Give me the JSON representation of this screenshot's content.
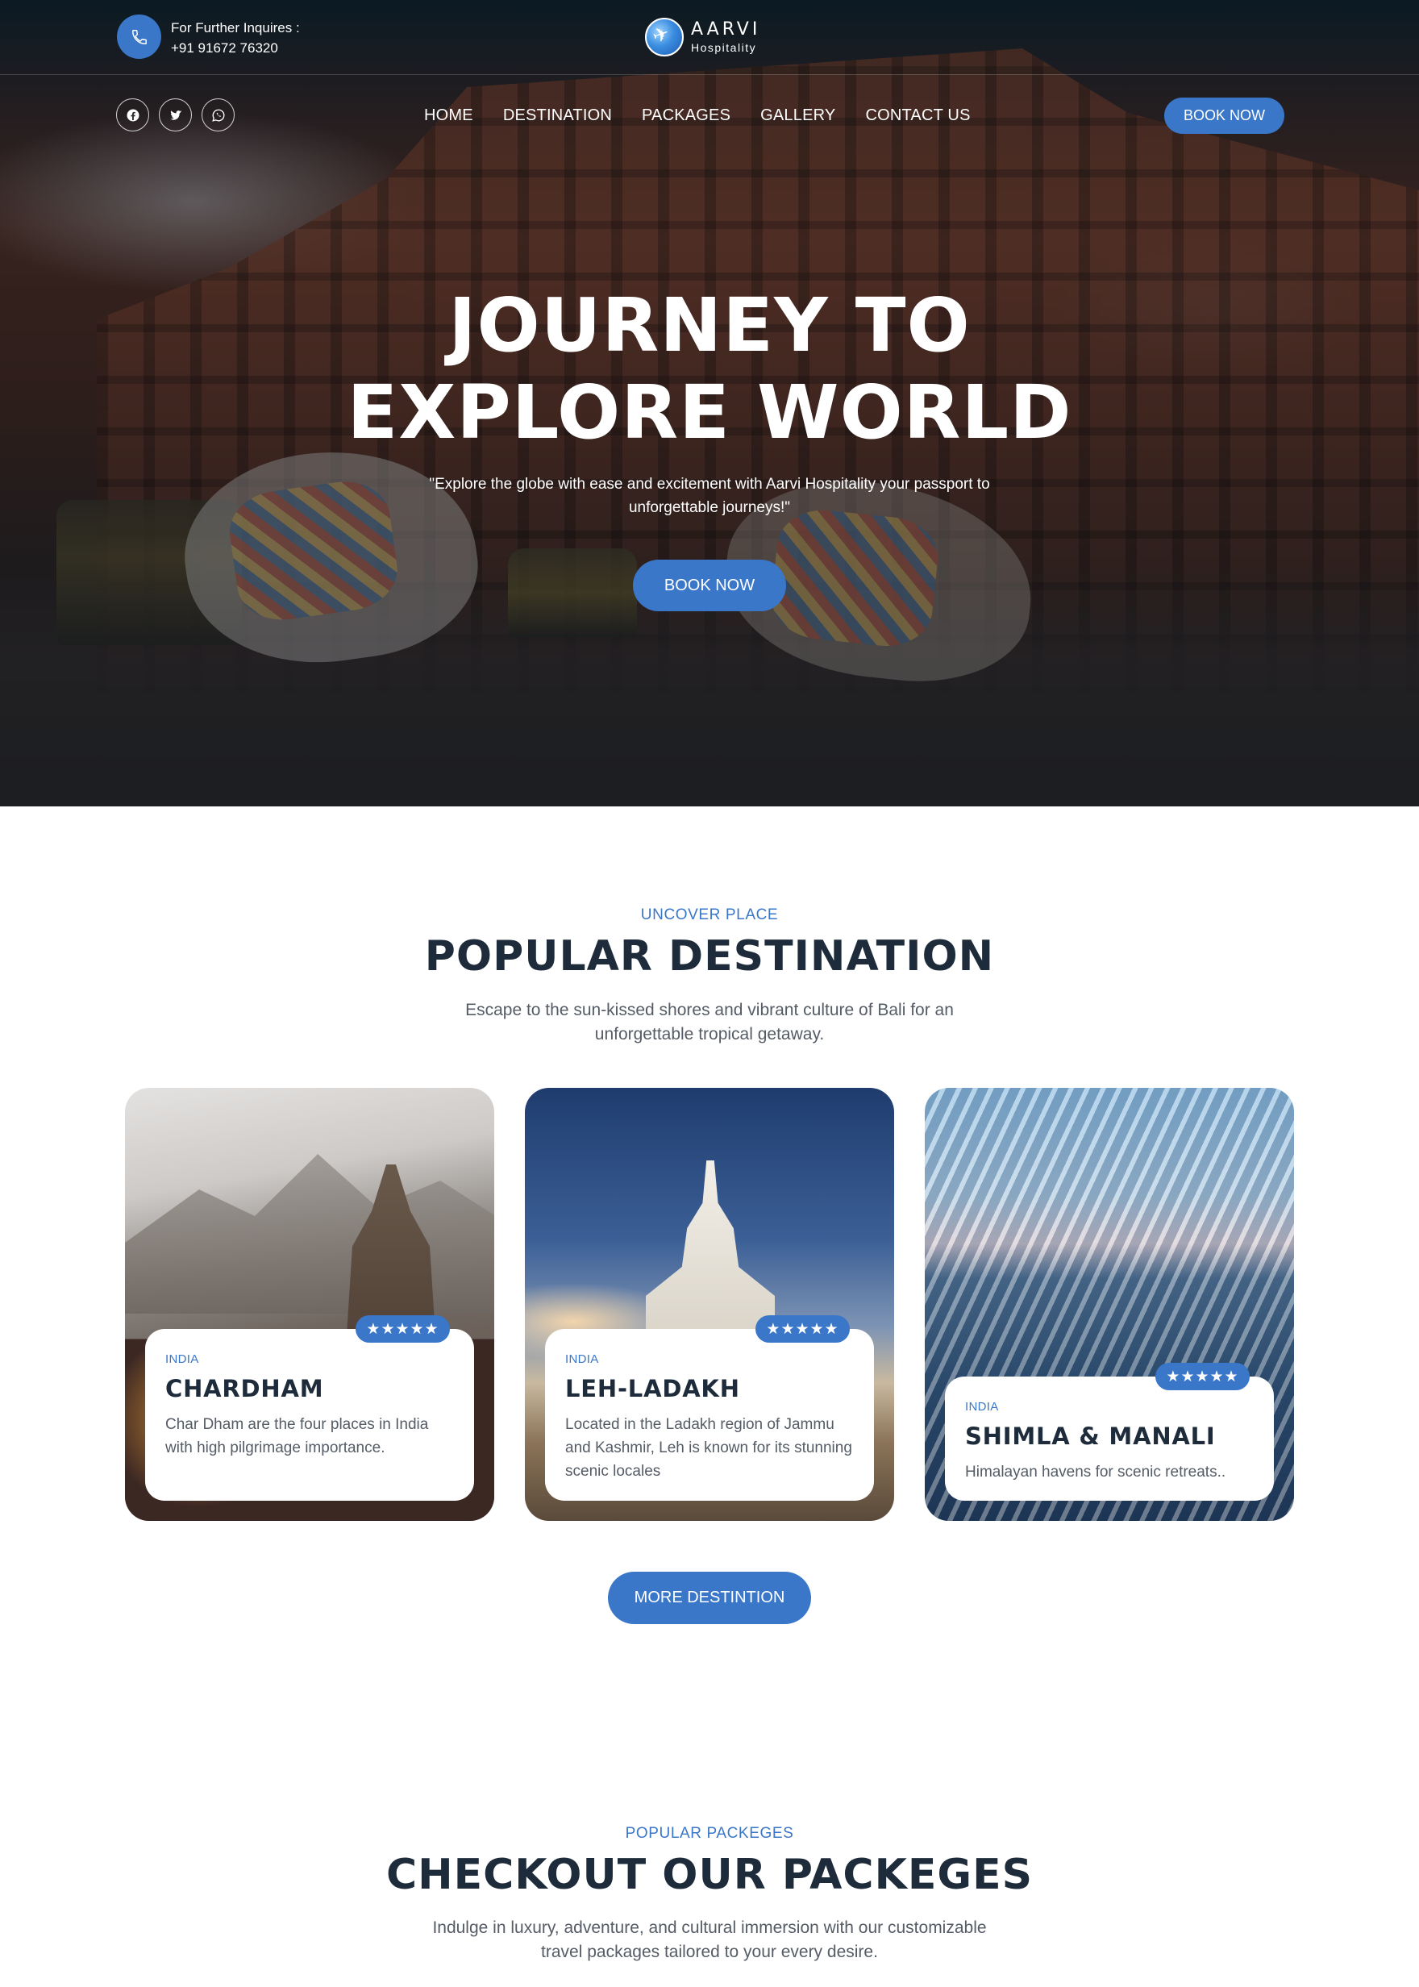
{
  "header": {
    "inquiry_label": "For Further Inquires :",
    "phone": "+91 91672 76320",
    "brand": "AARVI",
    "brand_sub": "Hospitality",
    "nav": [
      "HOME",
      "DESTINATION",
      "PACKAGES",
      "GALLERY",
      "CONTACT US"
    ],
    "book_label": "BOOK NOW",
    "socials": [
      "facebook-icon",
      "twitter-icon",
      "whatsapp-icon"
    ]
  },
  "hero": {
    "title_line1": "JOURNEY TO",
    "title_line2": "EXPLORE WORLD",
    "subtitle_line1": "\"Explore the globe with ease and excitement with Aarvi Hospitality your passport to",
    "subtitle_line2": "unforgettable journeys!\"",
    "button": "BOOK NOW"
  },
  "destinations": {
    "eyebrow": "UNCOVER PLACE",
    "title": "POPULAR DESTINATION",
    "desc_line1": "Escape to the sun-kissed shores and vibrant culture of Bali for an",
    "desc_line2": "unforgettable tropical getaway.",
    "cards": [
      {
        "country": "INDIA",
        "name": "CHARDHAM",
        "rating": "★★★★★",
        "desc": "Char Dham are the four places in India with high pilgrimage importance."
      },
      {
        "country": "INDIA",
        "name": "LEH-LADAKH",
        "rating": "★★★★★",
        "desc": "Located in the Ladakh region of Jammu and Kashmir, Leh is known for its stunning scenic locales"
      },
      {
        "country": "INDIA",
        "name": "SHIMLA & MANALI",
        "rating": "★★★★★",
        "desc": "Himalayan havens for scenic retreats.."
      }
    ],
    "more_button": "MORE DESTINTION"
  },
  "packages": {
    "eyebrow": "POPULAR PACKEGES",
    "title": "CHECKOUT OUR PACKEGES",
    "desc_line1": "Indulge in luxury, adventure, and cultural immersion with our customizable",
    "desc_line2": "travel packages tailored to your every desire."
  },
  "colors": {
    "accent": "#3a77c9",
    "heading": "#1d2b3a",
    "body_text": "#555c66"
  }
}
